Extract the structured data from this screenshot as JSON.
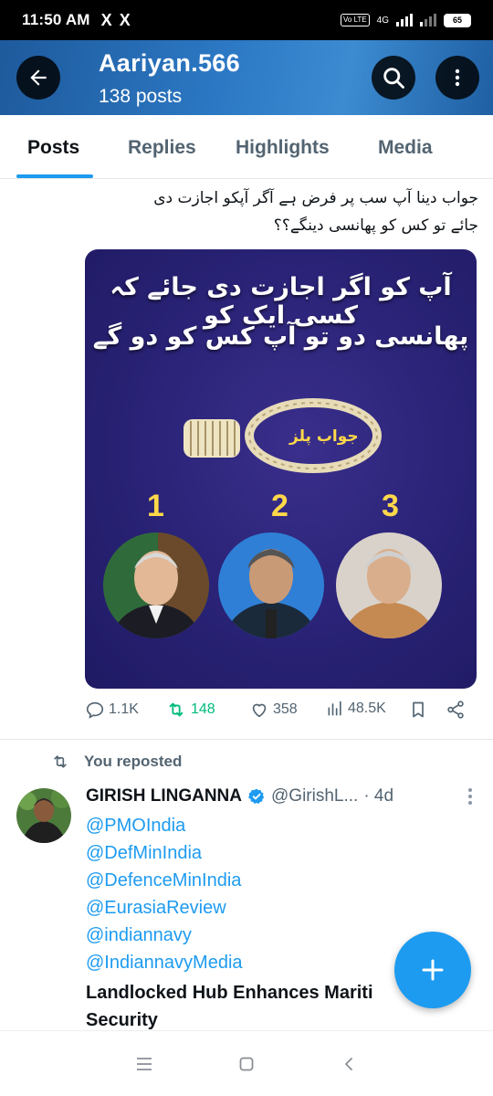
{
  "status_bar": {
    "time": "11:50 AM",
    "notif_icons": [
      "X",
      "X"
    ],
    "volte": "Vo LTE",
    "network": "4G",
    "battery": "65"
  },
  "header": {
    "title": "Aariyan.566",
    "subtitle": "138 posts"
  },
  "tabs": [
    {
      "label": "Posts",
      "active": true
    },
    {
      "label": "Replies",
      "active": false
    },
    {
      "label": "Highlights",
      "active": false
    },
    {
      "label": "Media",
      "active": false
    }
  ],
  "post1": {
    "text_line1": "جواب دینا آپ سب پر فرض ہے آگر آپکو اجازت دی",
    "text_line2": "جائے تو کس کو پھانسی دینگے؟؟",
    "image": {
      "line1": "آپ کو اگر اجازت دی جائے کہ کسی ایک کو",
      "line2": "پھانسی دو تو آپ کس کو دو گے",
      "noose_label": "جواب پلز",
      "numbers": [
        "1",
        "2",
        "3"
      ]
    },
    "actions": {
      "replies": "1.1K",
      "reposts": "148",
      "likes": "358",
      "views": "48.5K"
    }
  },
  "post2": {
    "repost_label": "You reposted",
    "author_name": "GIRISH LINGANNA",
    "author_handle": "@GirishL...",
    "time": "· 4d",
    "mentions": [
      "@PMOIndia",
      "@DefMinIndia",
      "@DefenceMinIndia",
      "@EurasiaReview",
      "@indiannavy",
      "@IndiannavyMedia"
    ],
    "headline_line1": "Landlocked Hub Enhances Mariti",
    "headline_line2": "Security"
  },
  "colors": {
    "accent": "#1d9bf0",
    "repost_green": "#00ba7c",
    "text": "#0f1419",
    "muted": "#536471"
  },
  "icons": [
    "back-arrow-icon",
    "search-icon",
    "more-vertical-icon",
    "reply-icon",
    "repost-icon",
    "like-icon",
    "views-icon",
    "bookmark-icon",
    "share-icon",
    "verified-icon",
    "compose-plus-icon",
    "nav-menu-icon",
    "nav-home-icon",
    "nav-back-icon"
  ]
}
